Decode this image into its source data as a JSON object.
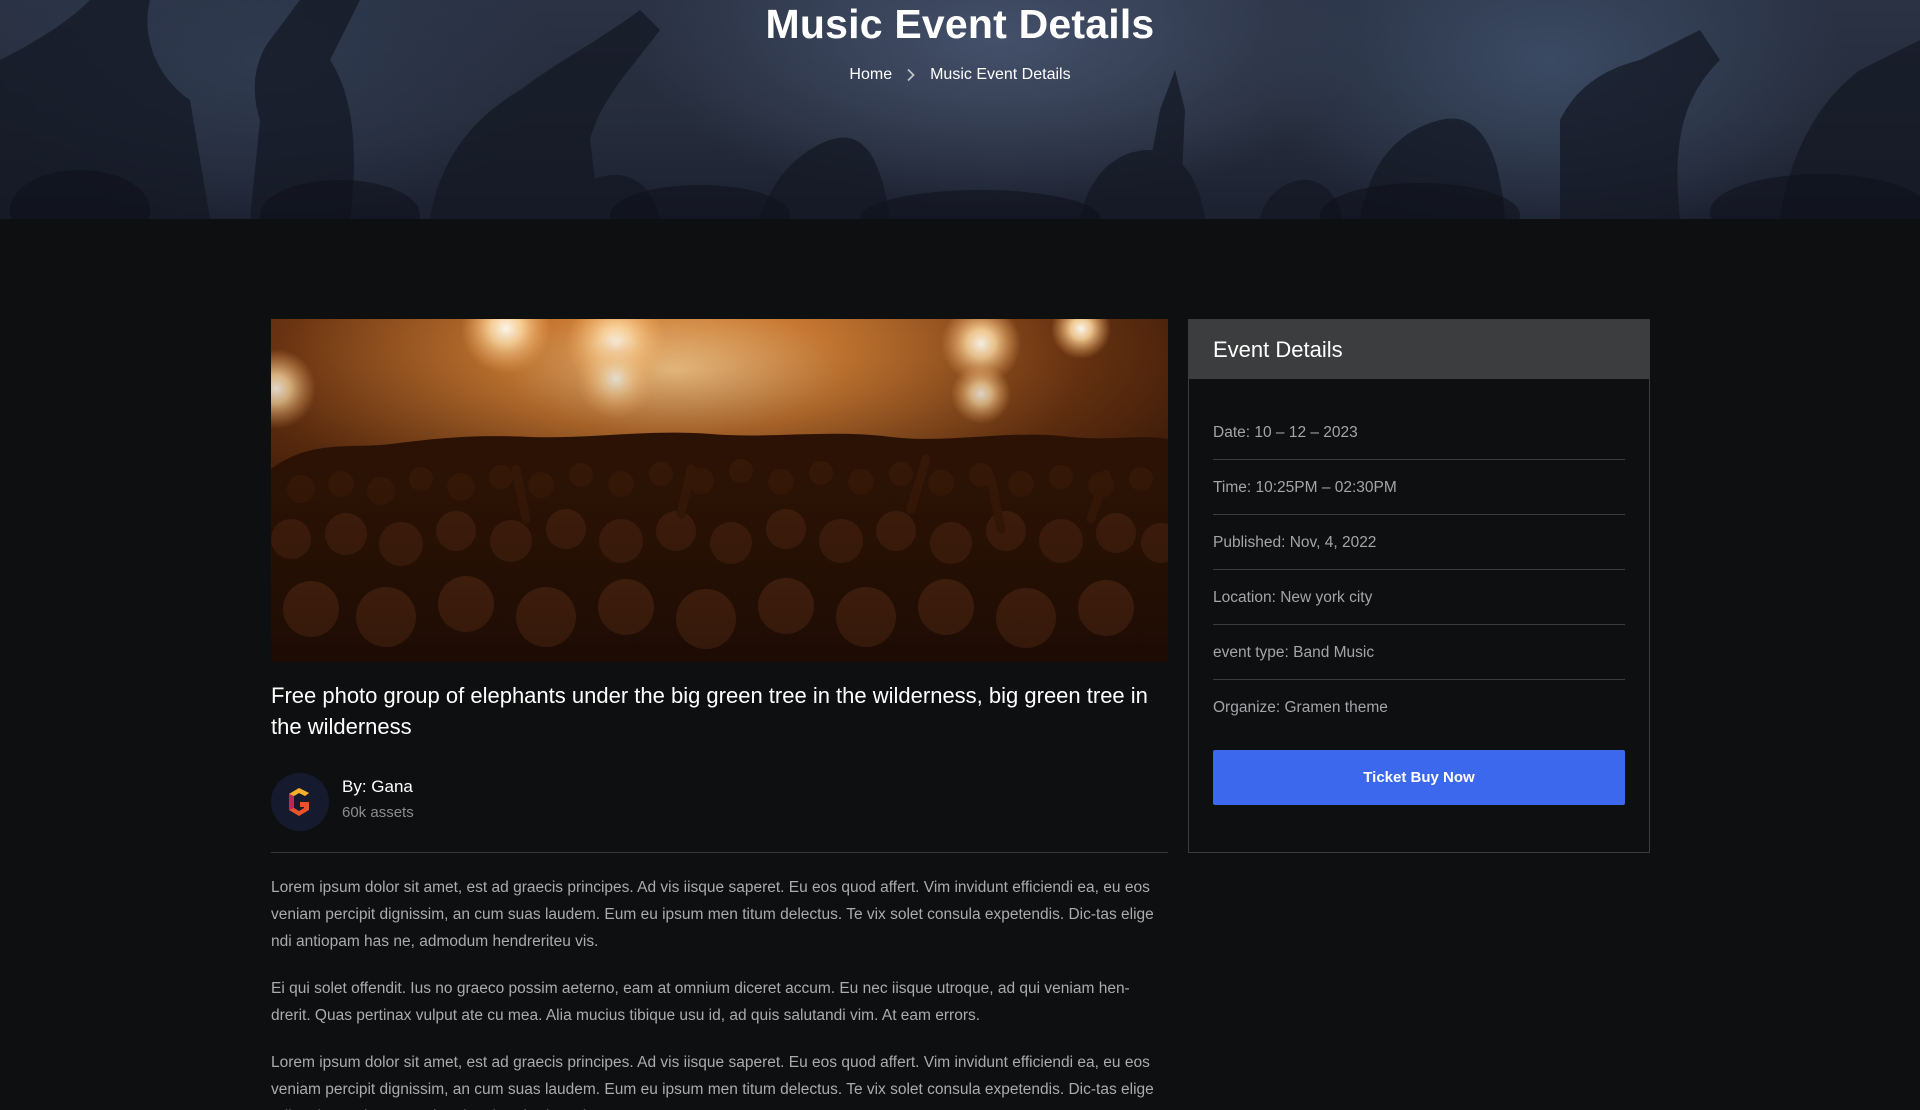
{
  "hero": {
    "title": "Music Event Details",
    "breadcrumb": {
      "home": "Home",
      "separator_icon": "chevron-right-icon",
      "current": "Music Event Details"
    }
  },
  "event": {
    "image_alt": "Concert crowd under stage lights",
    "title": "Free photo group of elephants under the big green tree in the wilderness, big green tree in the wilderness",
    "author": {
      "name": "By: Gana",
      "assets": "60k assets",
      "avatar_icon": "g-logo-icon"
    },
    "paragraphs": [
      "Lorem ipsum dolor sit amet, est ad graecis principes. Ad vis iisque saperet. Eu eos quod affert. Vim invidunt efficiendi ea, eu eos veniam percipit dignissim, an cum suas laudem. Eum eu ipsum men titum delectus. Te vix solet consula expetendis. Dic-tas elige ndi antiopam has ne, admodum hendreriteu vis.",
      "Ei qui solet offendit. Ius no graeco possim aeterno, eam at omnium diceret accum. Eu nec iisque utroque, ad qui veniam hen-drerit. Quas pertinax vulput ate cu mea. Alia mucius tibique usu id, ad quis salutandi vim. At eam errors.",
      "Lorem ipsum dolor sit amet, est ad graecis principes. Ad vis iisque saperet. Eu eos quod affert. Vim invidunt efficiendi ea, eu eos veniam percipit dignissim, an cum suas laudem. Eum eu ipsum men titum delectus. Te vix solet consula expetendis. Dic-tas elige ndi antiopam has ne, admodum hendreriteu vis."
    ]
  },
  "sidebar": {
    "title": "Event Details",
    "items": [
      "Date: 10 – 12 – 2023",
      "Time: 10:25PM – 02:30PM",
      "Published: Nov, 4, 2022",
      "Location: New york city",
      "event type: Band Music",
      "Organize: Gramen theme"
    ],
    "button_label": "Ticket Buy Now"
  },
  "colors": {
    "background": "#0e0f10",
    "accent": "#3c68ee",
    "sidebar_header": "#3c3d3f"
  }
}
